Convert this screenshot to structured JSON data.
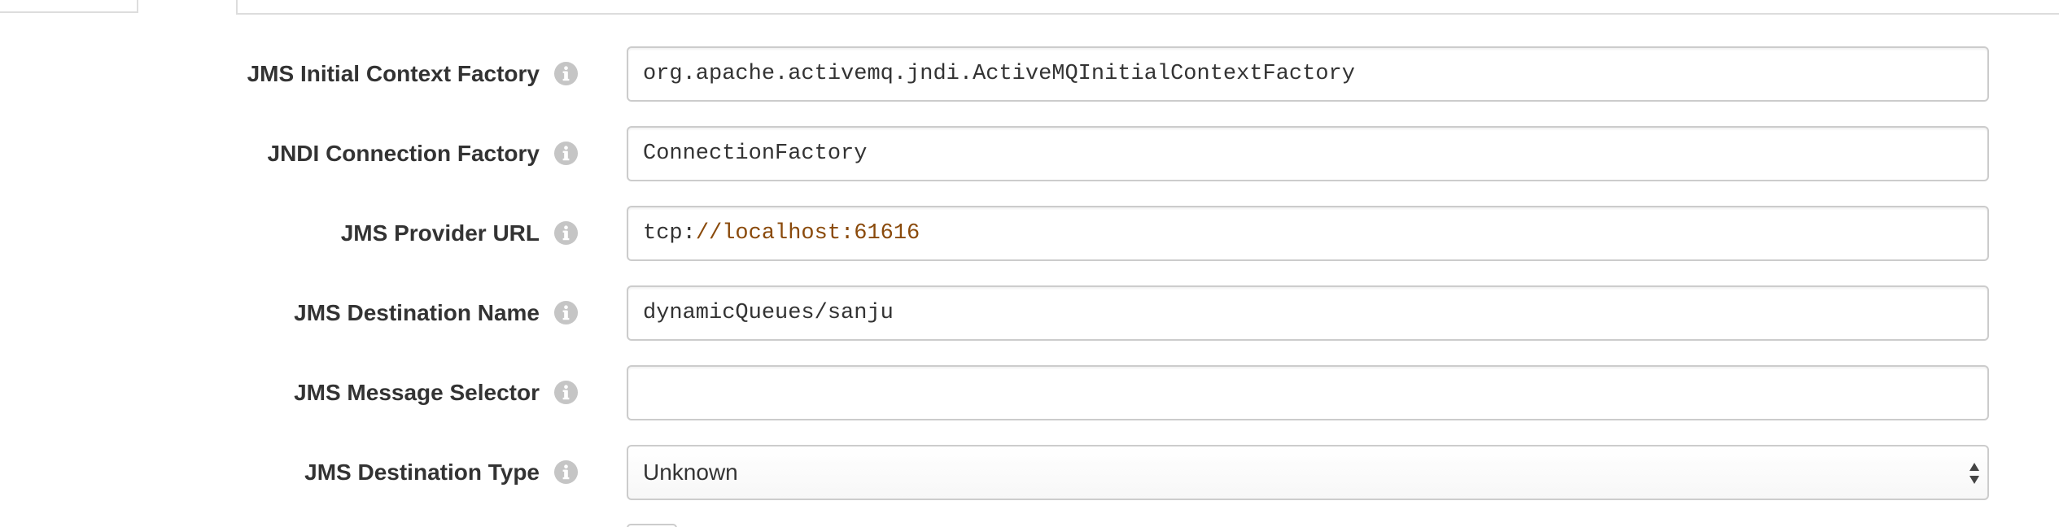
{
  "form": {
    "rows": [
      {
        "label": "JMS Initial Context Factory",
        "value": "org.apache.activemq.jndi.ActiveMQInitialContextFactory"
      },
      {
        "label": "JNDI Connection Factory",
        "value": "ConnectionFactory"
      },
      {
        "label": "JMS Provider URL",
        "value_scheme": "tcp:",
        "value_rest": "//localhost:61616"
      },
      {
        "label": "JMS Destination Name",
        "value": "dynamicQueues/sanju"
      },
      {
        "label": "JMS Message Selector",
        "value": ""
      },
      {
        "label": "JMS Destination Type",
        "selected": "Unknown"
      }
    ]
  },
  "icons": {
    "info": "info-circle-icon",
    "select_arrows": "sort-arrows-icon"
  },
  "colors": {
    "label_text": "#333333",
    "border": "#cccccc",
    "icon_gray": "#c5c5c5",
    "url_highlight": "#8a4a0b"
  }
}
